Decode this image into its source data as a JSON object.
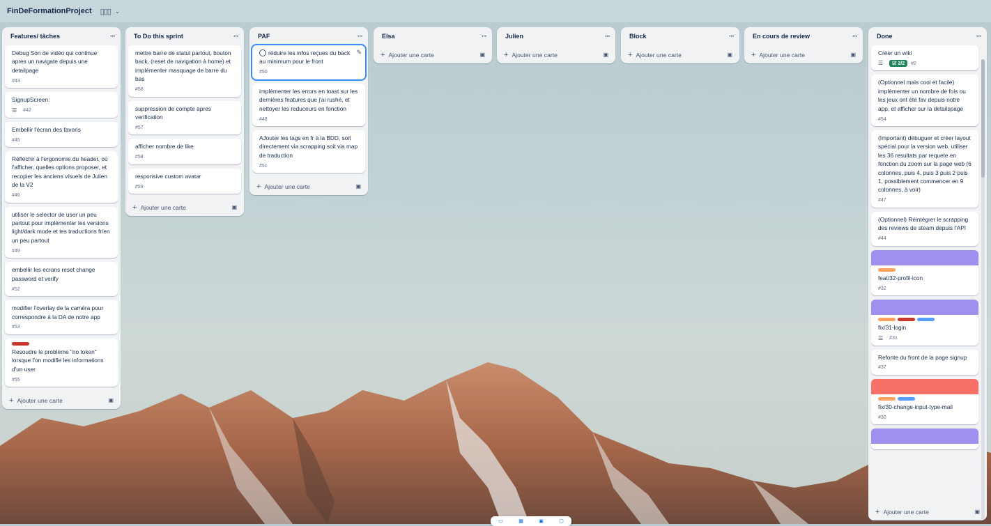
{
  "board": {
    "title": "FinDeFormationProject",
    "view_icon": "▯▯▯",
    "chevron": "⌄"
  },
  "add_card_label": "Ajouter une carte",
  "more_glyph": "···",
  "lists": {
    "features": {
      "title": "Features/ tâches",
      "cards": [
        {
          "text": "Debug Son de vidéo qui continue apres un navigate depuis une detailpage",
          "num": "#43"
        },
        {
          "text": "SignupScreen:",
          "num": "#42"
        },
        {
          "text": "Embellir l'écran des favoris",
          "num": "#45"
        },
        {
          "text": "Réfléchir à l'ergonomie du header, où l'afficher, quelles options proposer, et recopier les anciens visuels de Julien de la V2",
          "num": "#46"
        },
        {
          "text": "utiliser le selector de user un peu partout pour implémenter les versions light/dark mode et les traductions fr/en un peu partout",
          "num": "#49"
        },
        {
          "text": "embellir les ecrans reset change password et verify",
          "num": "#52"
        },
        {
          "text": "modifier l'overlay de la caméra pour correspondre à la DA de notre app",
          "num": "#53"
        },
        {
          "text": "Resoudre le problème \"no token\" lorsque l'on modifie les informations d'un user",
          "num": "#55"
        }
      ]
    },
    "todo": {
      "title": "To Do this sprint",
      "cards": [
        {
          "text": "mettre barre de statut partout, bouton back, (reset de navigation à home) et implémenter masquage de barre du bas",
          "num": "#56"
        },
        {
          "text": "suppression de compte apres verification",
          "num": "#57"
        },
        {
          "text": "afficher nombre de like",
          "num": "#58"
        },
        {
          "text": "responsive custom avatar",
          "num": "#59"
        }
      ]
    },
    "paf": {
      "title": "PAF",
      "cards": [
        {
          "text": "réduire les infos reçues du back au minimum pour le front",
          "num": "#50"
        },
        {
          "text": "implémenter les errors en toast sur les dernières features que j'ai rushé, et nettoyer les reduceurs en fonction",
          "num": "#48"
        },
        {
          "text": "AJouter les tags en fr à la BDD, soit directement via scrapping soit via map de traduction",
          "num": "#51"
        }
      ]
    },
    "elsa": {
      "title": "Elsa"
    },
    "julien": {
      "title": "Julien"
    },
    "block": {
      "title": "Block"
    },
    "review": {
      "title": "En cours de review"
    },
    "done": {
      "title": "Done",
      "cards": [
        {
          "text": "Créer un wiki",
          "num": "#2",
          "checklist": "2/2"
        },
        {
          "text": "(Optionnel mais cool et facile) implémenter un nombre de fois ou les jeux ont été fav depuis notre app, et afficher sur la detailspage",
          "num": "#54"
        },
        {
          "text": "(Important) débuguer et créer layout spécial pour la version web. utiliser les 36 resultats par requete en fonction du zoom sur la page web (6 colonnes, puis 4, puis 3 puis 2 puis 1, possiblement commencer en 9 colonnes, à voir)",
          "num": "#47"
        },
        {
          "text": "(Optionnel) Réintégrer le scrapping des reviews de steam depuis l'API",
          "num": "#44"
        },
        {
          "text": "feat/32-profil-icon",
          "num": "#32"
        },
        {
          "text": "fix/31-login",
          "num": "#31"
        },
        {
          "text": "Refonte du front de la page signup",
          "num": "#37"
        },
        {
          "text": "fix/30-change-input-type-mail",
          "num": "#30"
        }
      ]
    }
  },
  "colors": {
    "cover_purple": "#9f8fef",
    "cover_red": "#f87168",
    "label_orange": "#fea362",
    "label_red": "#c9372c",
    "label_blue": "#579dff",
    "focus_blue": "#388bff",
    "checklist_green": "#1f845a"
  }
}
